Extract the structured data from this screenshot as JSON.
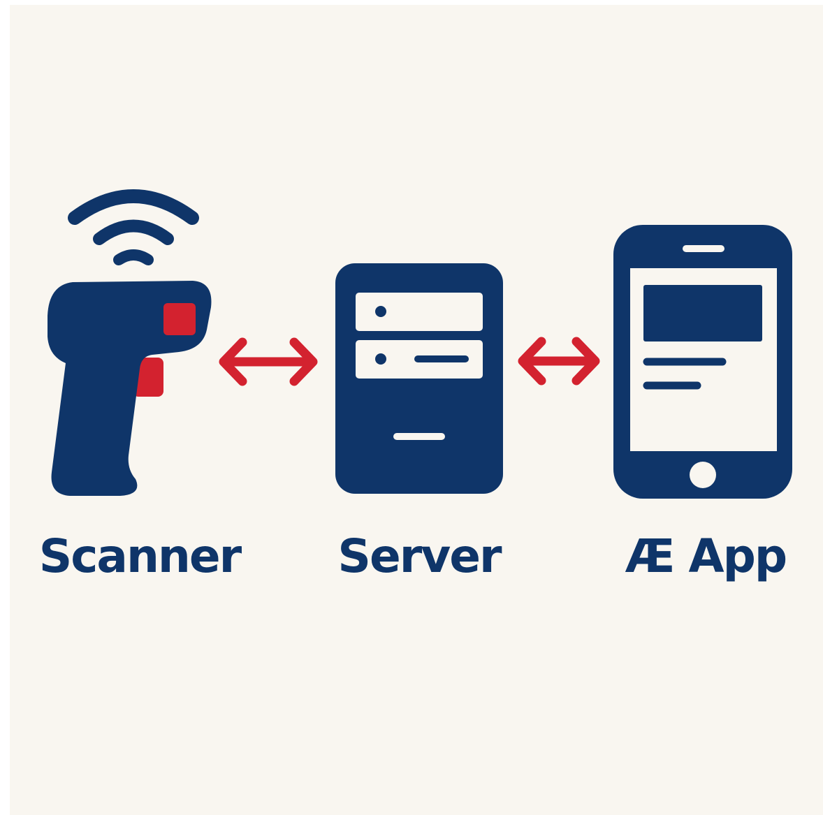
{
  "colors": {
    "navy": "#0f3569",
    "red": "#d3222f",
    "background": "#f9f6f0",
    "light": "#f9f6f0"
  },
  "nodes": [
    {
      "label": "Scanner",
      "icon": "barcode-scanner-icon"
    },
    {
      "label": "Server",
      "icon": "server-icon"
    },
    {
      "label": "Æ App",
      "icon": "smartphone-icon"
    }
  ],
  "connectors": [
    {
      "icon": "double-arrow-icon",
      "direction": "bidirectional"
    },
    {
      "icon": "double-arrow-icon",
      "direction": "bidirectional"
    }
  ]
}
